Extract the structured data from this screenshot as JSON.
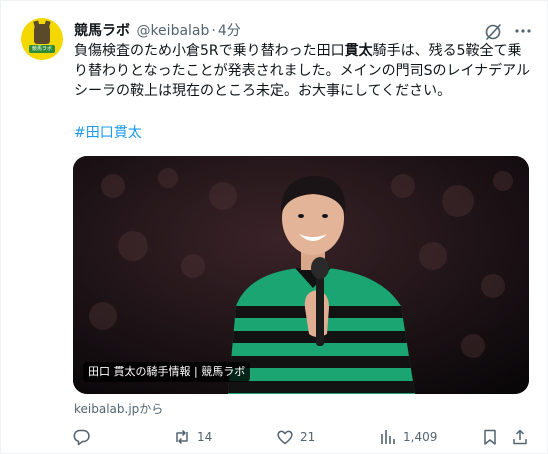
{
  "tweet": {
    "display_name": "競馬ラボ",
    "handle": "@keibalab",
    "separator": "·",
    "time": "4分",
    "text_part1": "負傷検査のため小倉5Rで乗り替わった田口",
    "text_bold": "貫太",
    "text_part2": "騎手は、残る5鞍全て乗り替わりとなったことが発表されました。メインの門司Sのレイナデアルシーラの鞍上は現在のところ未定。お大事にしてください。",
    "hashtag": "#田口貫太",
    "avatar_label": "競馬ラボ"
  },
  "card": {
    "overlay_label": "田口 貫太の騎手情報 | 競馬ラボ",
    "source": "keibalab.jpから"
  },
  "actions": {
    "replies": "",
    "retweets": "14",
    "likes": "21",
    "views": "1,409"
  },
  "icons": [
    "grok-icon",
    "more-icon",
    "reply-icon",
    "retweet-icon",
    "like-icon",
    "views-icon",
    "bookmark-icon",
    "share-icon"
  ],
  "colors": {
    "accent": "#1d9bf0",
    "secondary_text": "#536471",
    "avatar_bg": "#f4d800",
    "jersey_green": "#1aa572",
    "jersey_black": "#121212"
  }
}
